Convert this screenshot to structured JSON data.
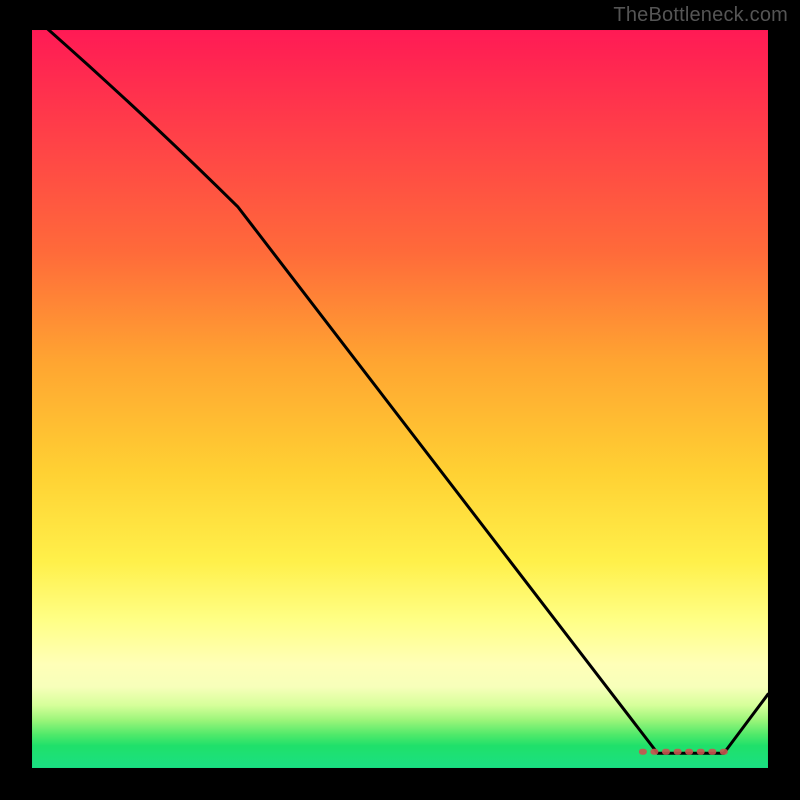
{
  "watermark": "TheBottleneck.com",
  "chart_data": {
    "type": "line",
    "title": "",
    "xlabel": "",
    "ylabel": "",
    "xlim": [
      0,
      100
    ],
    "ylim": [
      0,
      100
    ],
    "series": [
      {
        "name": "curve",
        "x": [
          0,
          28,
          85,
          94,
          100
        ],
        "y": [
          102,
          76,
          2,
          2,
          10
        ]
      }
    ],
    "markers": {
      "name": "optimal-range",
      "x_start": 83,
      "x_end": 94,
      "y": 2.2
    },
    "gradient_stops": [
      {
        "pos": 0.0,
        "color": "#ff1a55"
      },
      {
        "pos": 0.3,
        "color": "#ff6a3a"
      },
      {
        "pos": 0.6,
        "color": "#ffd133"
      },
      {
        "pos": 0.8,
        "color": "#ffff86"
      },
      {
        "pos": 0.95,
        "color": "#4fe96a"
      },
      {
        "pos": 1.0,
        "color": "#1adf83"
      }
    ]
  }
}
